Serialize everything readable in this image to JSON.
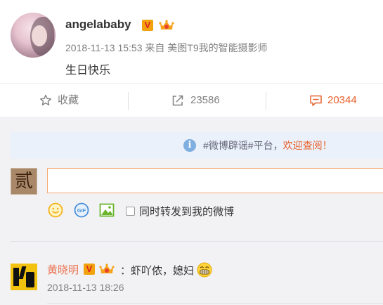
{
  "post": {
    "author": "angelababy",
    "meta": "2018-11-13 15:53 来自 美图T9我的智能摄影师",
    "content": "生日快乐"
  },
  "actions": {
    "favorite_label": "收藏",
    "repost_count": "23586",
    "comment_count": "20344"
  },
  "notice": {
    "prefix": "#微博辟谣#平台，",
    "highlight": "欢迎查阅！"
  },
  "composer": {
    "avatar_glyph": "贰",
    "input_value": "",
    "repost_checkbox_label": "同时转发到我的微博",
    "repost_checked": false
  },
  "comment": {
    "name": "黄晓明",
    "text": "：虾吖侬，媳妇",
    "time": "2018-11-13 18:26"
  },
  "colors": {
    "accent": "#e8622d",
    "comment_name": "#eb7350",
    "notice_bg": "#eaf1fb",
    "comments_bg": "#f2f2f5"
  }
}
